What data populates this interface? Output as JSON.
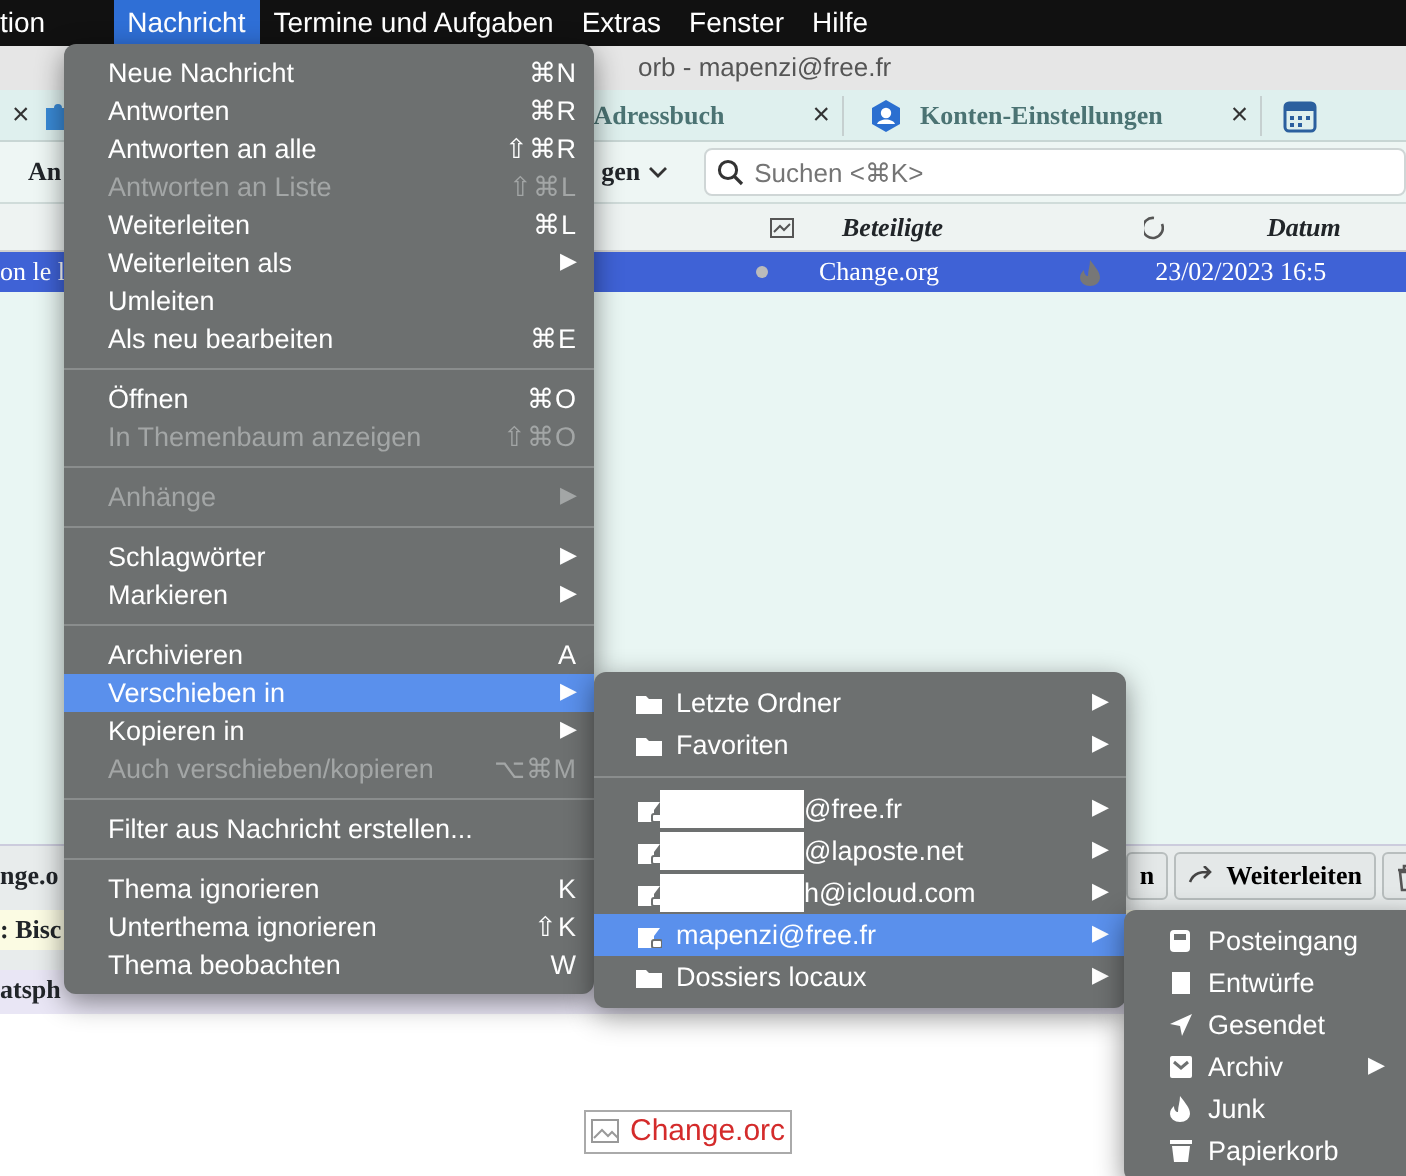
{
  "menubar": [
    {
      "label": "tion",
      "selected": false
    },
    {
      "label": "Nachricht",
      "selected": true
    },
    {
      "label": "Termine und Aufgaben",
      "selected": false
    },
    {
      "label": "Extras",
      "selected": false
    },
    {
      "label": "Fenster",
      "selected": false
    },
    {
      "label": "Hilfe",
      "selected": false
    }
  ],
  "window": {
    "title": "orb - mapenzi@free.fr"
  },
  "tabs": [
    {
      "label": "Adressbuch",
      "close": "×",
      "kind": "contacts"
    },
    {
      "label": "Konten-Einstellungen",
      "close": "×",
      "kind": "account"
    }
  ],
  "leading_close": "×",
  "toolbar": {
    "button_text": "An",
    "dropdown_text": "gen",
    "search": {
      "placeholder": "Suchen <⌘K>"
    }
  },
  "columns": [
    "Beteiligte",
    "Datum"
  ],
  "rows": [
    {
      "subject": "on le l",
      "participants": "Change.org",
      "date": "23/02/2023 16:5",
      "selected": true
    }
  ],
  "message_header": {
    "from": "nge.o",
    "subject": ": Bisc",
    "buttons": [
      "n",
      "Weiterleiten"
    ],
    "line": "atsph"
  },
  "body": {
    "image_text": "Change.orc"
  },
  "menu": [
    {
      "kind": "item",
      "label": "Neue Nachricht",
      "shortcut": "⌘N",
      "disabled": false,
      "selected": false
    },
    {
      "kind": "item",
      "label": "Antworten",
      "shortcut": "⌘R",
      "disabled": false,
      "selected": false
    },
    {
      "kind": "item",
      "label": "Antworten an alle",
      "shortcut": "⇧⌘R",
      "disabled": false,
      "selected": false
    },
    {
      "kind": "item",
      "label": "Antworten an Liste",
      "shortcut": "⇧⌘L",
      "disabled": true,
      "selected": false
    },
    {
      "kind": "item",
      "label": "Weiterleiten",
      "shortcut": "⌘L",
      "disabled": false,
      "selected": false
    },
    {
      "kind": "item",
      "label": "Weiterleiten als",
      "shortcut": "▶",
      "disabled": false,
      "selected": false
    },
    {
      "kind": "item",
      "label": "Umleiten",
      "disabled": false,
      "selected": false
    },
    {
      "kind": "item",
      "label": "Als neu bearbeiten",
      "shortcut": "⌘E",
      "disabled": false,
      "selected": false
    },
    {
      "kind": "separator"
    },
    {
      "kind": "item",
      "label": "Öffnen",
      "shortcut": "⌘O",
      "disabled": false,
      "selected": false
    },
    {
      "kind": "item",
      "label": "In Themenbaum anzeigen",
      "shortcut": "⇧⌘O",
      "disabled": true,
      "selected": false
    },
    {
      "kind": "separator"
    },
    {
      "kind": "item",
      "label": "Anhänge",
      "shortcut": "▶",
      "disabled": true,
      "selected": false
    },
    {
      "kind": "separator"
    },
    {
      "kind": "item",
      "label": "Schlagwörter",
      "shortcut": "▶",
      "disabled": false,
      "selected": false
    },
    {
      "kind": "item",
      "label": "Markieren",
      "shortcut": "▶",
      "disabled": false,
      "selected": false
    },
    {
      "kind": "separator"
    },
    {
      "kind": "item",
      "label": "Archivieren",
      "shortcut": "A",
      "disabled": false,
      "selected": false
    },
    {
      "kind": "item",
      "label": "Verschieben in",
      "shortcut": "▶",
      "disabled": false,
      "selected": true
    },
    {
      "kind": "item",
      "label": "Kopieren in",
      "shortcut": "▶",
      "disabled": false,
      "selected": false
    },
    {
      "kind": "item",
      "label": "Auch verschieben/kopieren",
      "shortcut": "⌥⌘M",
      "disabled": true,
      "selected": false
    },
    {
      "kind": "separator"
    },
    {
      "kind": "item",
      "label": "Filter aus Nachricht erstellen...",
      "disabled": false,
      "selected": false
    },
    {
      "kind": "separator"
    },
    {
      "kind": "item",
      "label": "Thema ignorieren",
      "shortcut": "K",
      "disabled": false,
      "selected": false
    },
    {
      "kind": "item",
      "label": "Unterthema ignorieren",
      "shortcut": "⇧K",
      "disabled": false,
      "selected": false
    },
    {
      "kind": "item",
      "label": "Thema beobachten",
      "shortcut": "W",
      "disabled": false,
      "selected": false
    }
  ],
  "submenu": [
    {
      "kind": "folder",
      "label": "Letzte Ordner",
      "arrow": "▶",
      "selected": false
    },
    {
      "kind": "folder",
      "label": "Favoriten",
      "arrow": "▶",
      "selected": false
    },
    {
      "kind": "separator"
    },
    {
      "kind": "account",
      "label": "@free.fr",
      "arrow": "▶",
      "redacted": true,
      "selected": false
    },
    {
      "kind": "account",
      "label": "@laposte.net",
      "arrow": "▶",
      "redacted": true,
      "selected": false
    },
    {
      "kind": "account",
      "label": "h@icloud.com",
      "arrow": "▶",
      "redacted": true,
      "selected": false
    },
    {
      "kind": "account",
      "label": "mapenzi@free.fr",
      "arrow": "▶",
      "redacted": false,
      "selected": true
    },
    {
      "kind": "folder",
      "label": "Dossiers locaux",
      "arrow": "▶",
      "selected": false
    }
  ],
  "folder_menu": [
    {
      "kind": "inbox",
      "label": "Posteingang"
    },
    {
      "kind": "drafts",
      "label": "Entwürfe"
    },
    {
      "kind": "sent",
      "label": "Gesendet"
    },
    {
      "kind": "archive",
      "label": "Archiv",
      "arrow": "▶"
    },
    {
      "kind": "junk",
      "label": "Junk"
    },
    {
      "kind": "trash",
      "label": "Papierkorb"
    }
  ]
}
